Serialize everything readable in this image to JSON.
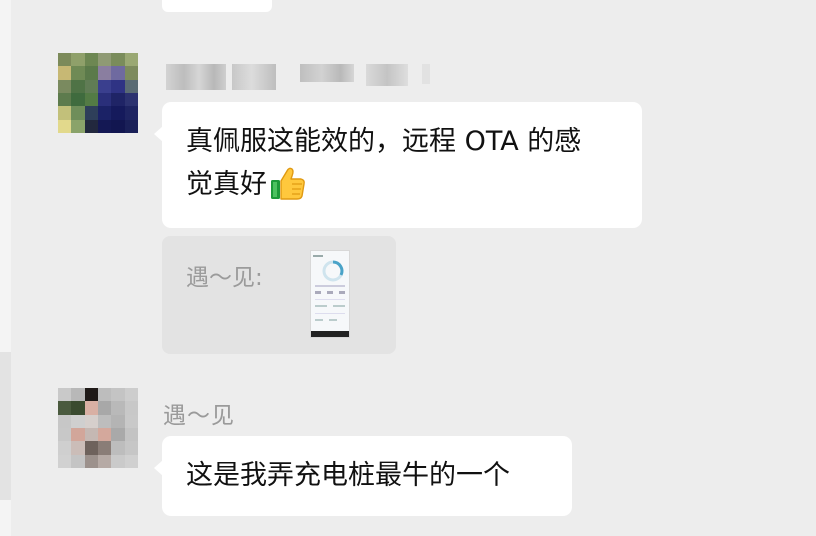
{
  "chat": {
    "messages": [
      {
        "sender": "",
        "sender_pixelated": true,
        "text_line1": "真佩服这能效的，远程 OTA 的感",
        "text_line2": "觉真好",
        "emoji": "thumbs-up-icon"
      },
      {
        "quote_author": "遇～见:",
        "quote_content": "screenshot-thumbnail"
      },
      {
        "sender": "遇～见",
        "text": "这是我弄充电桩最牛的一个"
      }
    ]
  },
  "colors": {
    "background": "#ededed",
    "bubble": "#ffffff",
    "quote_bg": "#e3e3e3",
    "sender_name": "#9a9a9a",
    "message_text": "#111111"
  }
}
